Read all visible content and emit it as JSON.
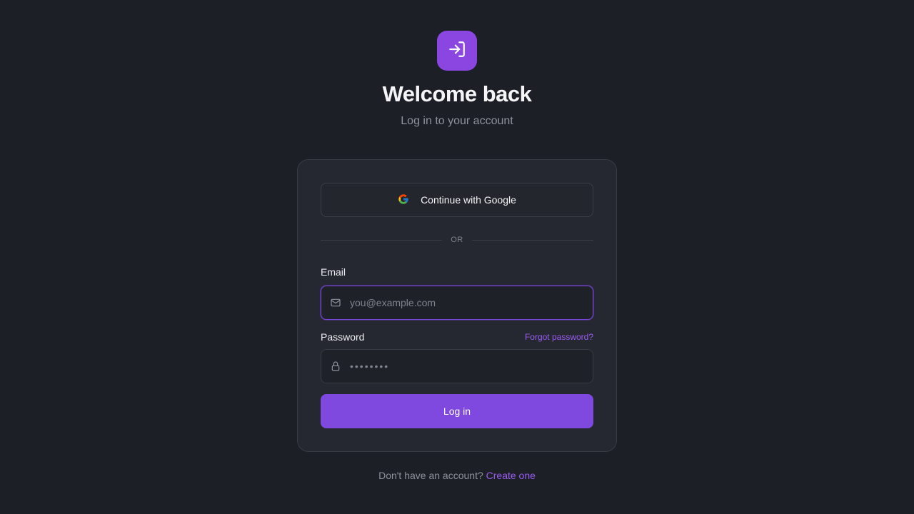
{
  "header": {
    "logo_icon": "login-icon",
    "title": "Welcome back",
    "subtitle": "Log in to your account"
  },
  "colors": {
    "accent": "#7f48df",
    "background": "#1d1f26",
    "card": "#252830",
    "link": "#9a5cf0"
  },
  "form": {
    "google_label": "Continue with Google",
    "google_icon": "google-icon",
    "divider_text": "OR",
    "email": {
      "label": "Email",
      "icon": "mail-icon",
      "placeholder": "you@example.com",
      "value": ""
    },
    "password": {
      "label": "Password",
      "icon": "lock-icon",
      "placeholder": "••••••••",
      "value": "",
      "forgot_label": "Forgot password?"
    },
    "submit_label": "Log in"
  },
  "footer": {
    "prompt": "Don't have an account?",
    "link_label": "Create one"
  }
}
